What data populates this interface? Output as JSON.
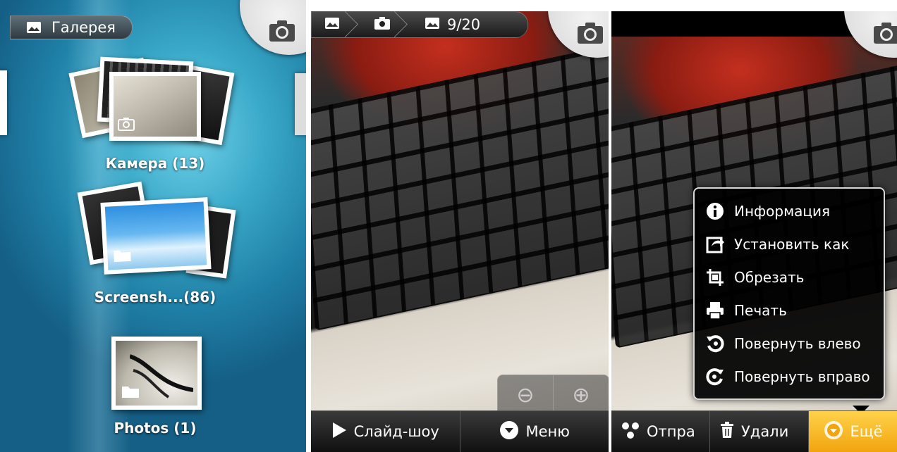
{
  "gallery": {
    "title": "Галерея",
    "albums": [
      {
        "name": "Камера (13)"
      },
      {
        "name": "Screensh...(86)"
      },
      {
        "name": "Photos (1)"
      }
    ]
  },
  "viewer": {
    "counter": "9/20",
    "slideshow_label": "Слайд-шоу",
    "menu_label": "Меню"
  },
  "viewer_menu": {
    "share_label": "Отпра",
    "delete_label": "Удали",
    "more_label": "Ещё",
    "items": [
      {
        "label": "Информация",
        "icon": "info-icon"
      },
      {
        "label": "Установить как",
        "icon": "set-as-icon"
      },
      {
        "label": "Обрезать",
        "icon": "crop-icon"
      },
      {
        "label": "Печать",
        "icon": "print-icon"
      },
      {
        "label": "Повернуть влево",
        "icon": "rotate-left-icon"
      },
      {
        "label": "Повернуть вправо",
        "icon": "rotate-right-icon"
      }
    ]
  },
  "colors": {
    "accent": "#f5b21b",
    "gallery_bg": "#2a90b5"
  }
}
